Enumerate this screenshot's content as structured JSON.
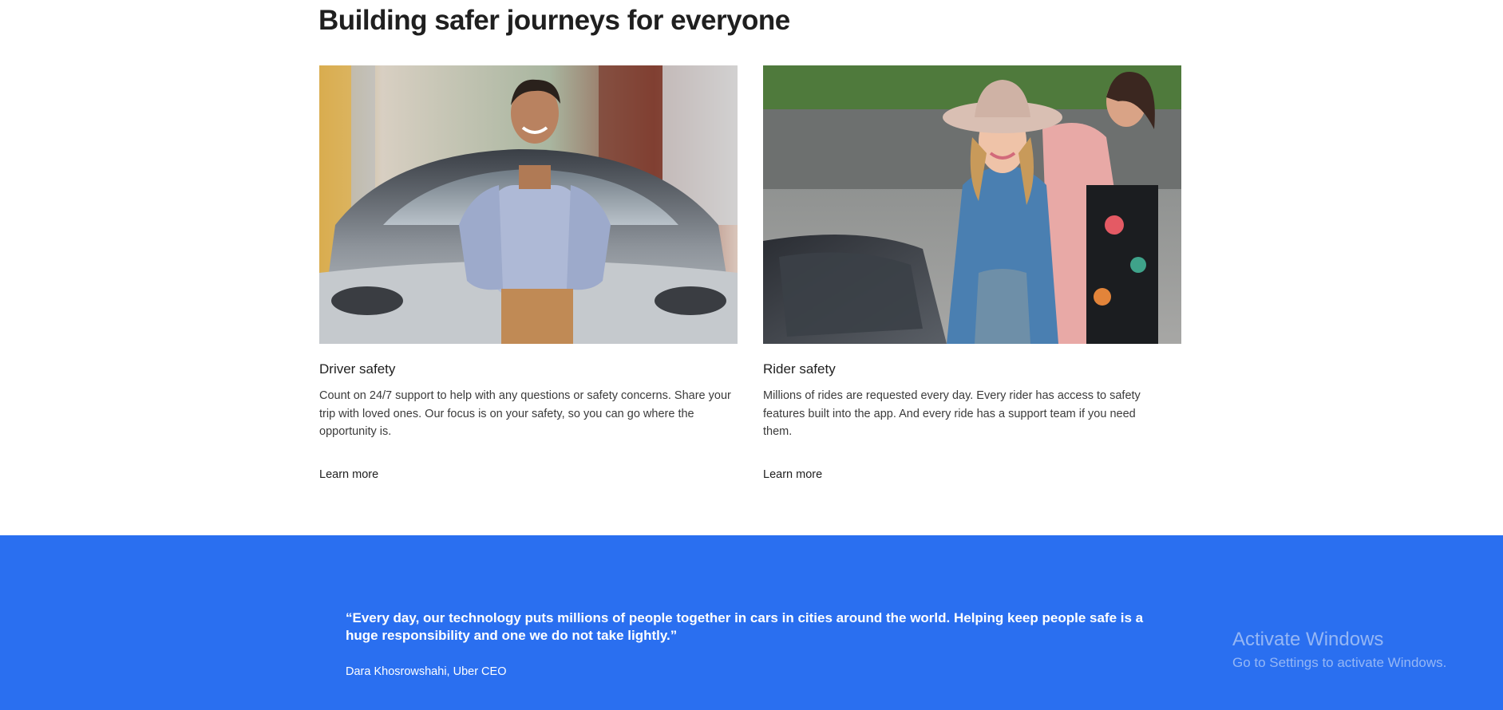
{
  "section": {
    "title": "Building safer journeys for everyone"
  },
  "cards": [
    {
      "heading": "Driver safety",
      "text": "Count on 24/7 support to help with any questions or safety concerns. Share your trip with loved ones. Our focus is on your safety, so you can go where the opportunity is.",
      "link": "Learn more",
      "image_alt": "Smiling man leaning on the hood of a car"
    },
    {
      "heading": "Rider safety",
      "text": "Millions of rides are requested every day. Every rider has access to safety features built into the app. And every ride has a support team if you need them.",
      "link": "Learn more",
      "image_alt": "Woman in a hat and denim jacket getting into a car"
    }
  ],
  "quote": {
    "text": "“Every day, our technology puts millions of people together in cars in cities around the world. Helping keep people safe is a huge responsibility and one we do not take lightly.”",
    "author": "Dara Khosrowshahi, Uber CEO"
  },
  "watermark": {
    "title": "Activate Windows",
    "subtitle": "Go to Settings to activate Windows."
  },
  "colors": {
    "quote_band": "#2a6ff0",
    "heading": "#1f1f1f"
  }
}
